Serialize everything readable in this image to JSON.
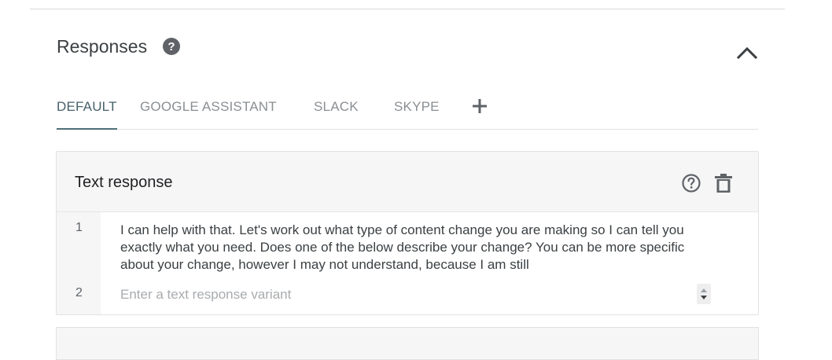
{
  "section": {
    "title": "Responses",
    "help_icon": "question-circle-filled-icon",
    "collapse_icon": "chevron-up-icon"
  },
  "tabs": [
    {
      "label": "DEFAULT",
      "active": true
    },
    {
      "label": "GOOGLE ASSISTANT",
      "active": false
    },
    {
      "label": "SLACK",
      "active": false
    },
    {
      "label": "SKYPE",
      "active": false
    }
  ],
  "add_tab_icon": "plus-icon",
  "card": {
    "title": "Text response",
    "help_icon": "question-circle-outline-icon",
    "delete_icon": "trash-icon",
    "lines": [
      {
        "number": "1",
        "text": "I can help with that. Let's work out what type of content change you are making so I can tell you exactly what you need. Does one of the below describe your change? You can be more specific about your change, however I may not understand, because I am still"
      },
      {
        "number": "2",
        "placeholder": "Enter a text response variant"
      }
    ]
  },
  "colors": {
    "active_tab": "#47616a",
    "tab_underline": "#4f6e77",
    "inactive_tab": "#8a8f93",
    "card_header_bg": "#f6f6f6"
  }
}
